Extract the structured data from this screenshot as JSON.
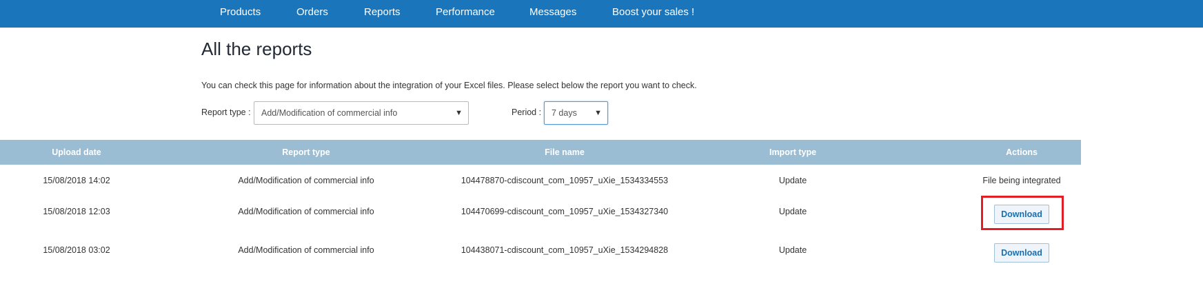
{
  "nav": {
    "items": [
      "Products",
      "Orders",
      "Reports",
      "Performance",
      "Messages",
      "Boost your sales !"
    ]
  },
  "page": {
    "title": "All the reports",
    "intro": "You can check this page for information about the integration of your Excel files. Please select below the report you want to check."
  },
  "filters": {
    "report_type_label": "Report type :",
    "report_type_value": "Add/Modification of commercial info",
    "period_label": "Period :",
    "period_value": "7 days"
  },
  "table": {
    "columns": [
      "Upload date",
      "Report type",
      "File name",
      "Import type",
      "Actions"
    ],
    "rows": [
      {
        "upload_date": "15/08/2018 14:02",
        "report_type": "Add/Modification of commercial info",
        "file_name": "104478870-cdiscount_com_10957_uXie_1534334553",
        "import_type": "Update",
        "action": "File being integrated"
      },
      {
        "upload_date": "15/08/2018 12:03",
        "report_type": "Add/Modification of commercial info",
        "file_name": "104470699-cdiscount_com_10957_uXie_1534327340",
        "import_type": "Update",
        "action": "Download"
      },
      {
        "upload_date": "15/08/2018 03:02",
        "report_type": "Add/Modification of commercial info",
        "file_name": "104438071-cdiscount_com_10957_uXie_1534294828",
        "import_type": "Update",
        "action": "Download"
      }
    ]
  },
  "colors": {
    "nav_bg": "#1b75bb",
    "table_header_bg": "#9bbdd4",
    "highlight": "#e21d24"
  }
}
